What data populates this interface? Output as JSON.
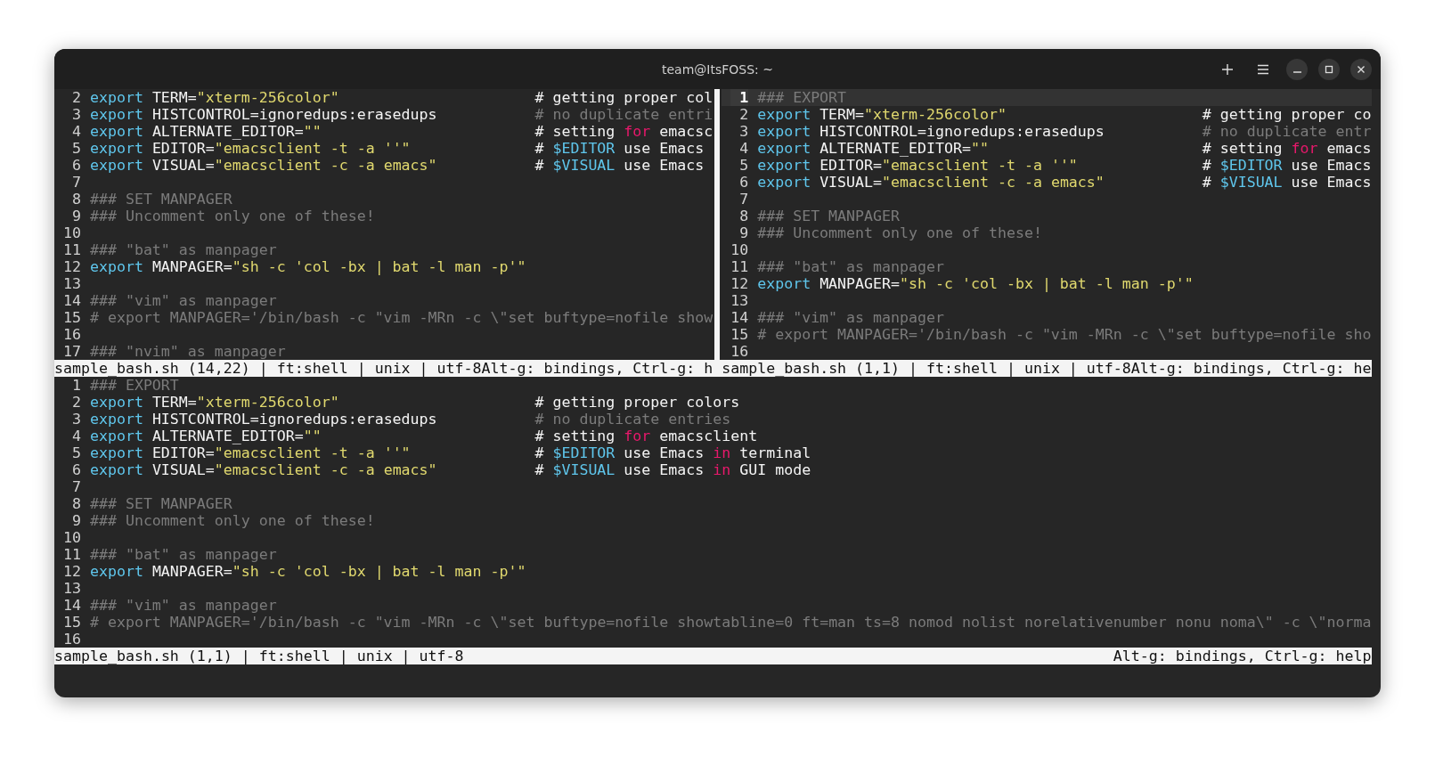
{
  "window": {
    "title": "team@ItsFOSS: ~"
  },
  "top_panes": [
    {
      "lines": [
        {
          "number": "2",
          "current": false,
          "code": [
            {
              "kind": "kw",
              "text": "export"
            },
            {
              "kind": "plain",
              "text": " TERM="
            },
            {
              "kind": "str",
              "text": "\"xterm-256color\""
            }
          ],
          "comment": [
            {
              "kind": "plain",
              "text": "# getting proper col"
            }
          ]
        },
        {
          "number": "3",
          "current": false,
          "code": [
            {
              "kind": "kw",
              "text": "export"
            },
            {
              "kind": "plain",
              "text": " HISTCONTROL=ignoredups:erasedups"
            }
          ],
          "comment": [
            {
              "kind": "com",
              "text": "# no duplicate entri"
            }
          ]
        },
        {
          "number": "4",
          "current": false,
          "code": [
            {
              "kind": "kw",
              "text": "export"
            },
            {
              "kind": "plain",
              "text": " ALTERNATE_EDITOR="
            },
            {
              "kind": "str",
              "text": "\"\""
            }
          ],
          "comment": [
            {
              "kind": "plain",
              "text": "# setting "
            },
            {
              "kind": "key",
              "text": "for"
            },
            {
              "kind": "plain",
              "text": " emacsc"
            }
          ]
        },
        {
          "number": "5",
          "current": false,
          "code": [
            {
              "kind": "kw",
              "text": "export"
            },
            {
              "kind": "plain",
              "text": " EDITOR="
            },
            {
              "kind": "str",
              "text": "\"emacsclient -t -a ''\""
            }
          ],
          "comment": [
            {
              "kind": "plain",
              "text": "# "
            },
            {
              "kind": "var",
              "text": "$EDITOR"
            },
            {
              "kind": "plain",
              "text": " use Emacs"
            }
          ]
        },
        {
          "number": "6",
          "current": false,
          "code": [
            {
              "kind": "kw",
              "text": "export"
            },
            {
              "kind": "plain",
              "text": " VISUAL="
            },
            {
              "kind": "str",
              "text": "\"emacsclient -c -a emacs\""
            }
          ],
          "comment": [
            {
              "kind": "plain",
              "text": "# "
            },
            {
              "kind": "var",
              "text": "$VISUAL"
            },
            {
              "kind": "plain",
              "text": " use Emacs"
            }
          ]
        },
        {
          "number": "7",
          "current": false
        },
        {
          "number": "8",
          "current": false,
          "code": [
            {
              "kind": "com",
              "text": "### SET MANPAGER"
            }
          ]
        },
        {
          "number": "9",
          "current": false,
          "code": [
            {
              "kind": "com",
              "text": "### Uncomment only one of these!"
            }
          ]
        },
        {
          "number": "10",
          "current": false
        },
        {
          "number": "11",
          "current": false,
          "code": [
            {
              "kind": "com",
              "text": "### \"bat\" as manpager"
            }
          ]
        },
        {
          "number": "12",
          "current": false,
          "code": [
            {
              "kind": "kw",
              "text": "export"
            },
            {
              "kind": "plain",
              "text": " MANPAGER="
            },
            {
              "kind": "str",
              "text": "\"sh -c 'col -bx | bat -l man -p'\""
            }
          ]
        },
        {
          "number": "13",
          "current": false
        },
        {
          "number": "14",
          "current": false,
          "code": [
            {
              "kind": "com",
              "text": "### \"vim\" as manpager"
            }
          ]
        },
        {
          "number": "15",
          "current": false,
          "code": [
            {
              "kind": "com",
              "text": "# export MANPAGER='/bin/bash -c \"vim -MRn -c \\\"set buftype=nofile show"
            }
          ]
        },
        {
          "number": "16",
          "current": false
        },
        {
          "number": "17",
          "current": false,
          "code": [
            {
              "kind": "com",
              "text": "### \"nvim\" as manpager"
            }
          ]
        }
      ],
      "status": "sample_bash.sh (14,22) | ft:shell | unix | utf-8Alt-g: bindings, Ctrl-g: h"
    },
    {
      "lines": [
        {
          "number": "1",
          "current": true,
          "code": [
            {
              "kind": "com",
              "text": "### EXPORT"
            }
          ]
        },
        {
          "number": "2",
          "current": false,
          "code": [
            {
              "kind": "kw",
              "text": "export"
            },
            {
              "kind": "plain",
              "text": " TERM="
            },
            {
              "kind": "str",
              "text": "\"xterm-256color\""
            }
          ],
          "comment": [
            {
              "kind": "plain",
              "text": "# getting proper co"
            }
          ]
        },
        {
          "number": "3",
          "current": false,
          "code": [
            {
              "kind": "kw",
              "text": "export"
            },
            {
              "kind": "plain",
              "text": " HISTCONTROL=ignoredups:erasedups"
            }
          ],
          "comment": [
            {
              "kind": "com",
              "text": "# no duplicate entr"
            }
          ]
        },
        {
          "number": "4",
          "current": false,
          "code": [
            {
              "kind": "kw",
              "text": "export"
            },
            {
              "kind": "plain",
              "text": " ALTERNATE_EDITOR="
            },
            {
              "kind": "str",
              "text": "\"\""
            }
          ],
          "comment": [
            {
              "kind": "plain",
              "text": "# setting "
            },
            {
              "kind": "key",
              "text": "for"
            },
            {
              "kind": "plain",
              "text": " emacs"
            }
          ]
        },
        {
          "number": "5",
          "current": false,
          "code": [
            {
              "kind": "kw",
              "text": "export"
            },
            {
              "kind": "plain",
              "text": " EDITOR="
            },
            {
              "kind": "str",
              "text": "\"emacsclient -t -a ''\""
            }
          ],
          "comment": [
            {
              "kind": "plain",
              "text": "# "
            },
            {
              "kind": "var",
              "text": "$EDITOR"
            },
            {
              "kind": "plain",
              "text": " use Emacs"
            }
          ]
        },
        {
          "number": "6",
          "current": false,
          "code": [
            {
              "kind": "kw",
              "text": "export"
            },
            {
              "kind": "plain",
              "text": " VISUAL="
            },
            {
              "kind": "str",
              "text": "\"emacsclient -c -a emacs\""
            }
          ],
          "comment": [
            {
              "kind": "plain",
              "text": "# "
            },
            {
              "kind": "var",
              "text": "$VISUAL"
            },
            {
              "kind": "plain",
              "text": " use Emacs"
            }
          ]
        },
        {
          "number": "7",
          "current": false
        },
        {
          "number": "8",
          "current": false,
          "code": [
            {
              "kind": "com",
              "text": "### SET MANPAGER"
            }
          ]
        },
        {
          "number": "9",
          "current": false,
          "code": [
            {
              "kind": "com",
              "text": "### Uncomment only one of these!"
            }
          ]
        },
        {
          "number": "10",
          "current": false
        },
        {
          "number": "11",
          "current": false,
          "code": [
            {
              "kind": "com",
              "text": "### \"bat\" as manpager"
            }
          ]
        },
        {
          "number": "12",
          "current": false,
          "code": [
            {
              "kind": "kw",
              "text": "export"
            },
            {
              "kind": "plain",
              "text": " MANPAGER="
            },
            {
              "kind": "str",
              "text": "\"sh -c 'col -bx | bat -l man -p'\""
            }
          ]
        },
        {
          "number": "13",
          "current": false
        },
        {
          "number": "14",
          "current": false,
          "code": [
            {
              "kind": "com",
              "text": "### \"vim\" as manpager"
            }
          ]
        },
        {
          "number": "15",
          "current": false,
          "code": [
            {
              "kind": "com",
              "text": "# export MANPAGER='/bin/bash -c \"vim -MRn -c \\\"set buftype=nofile sho"
            }
          ]
        },
        {
          "number": "16",
          "current": false
        }
      ],
      "status": "sample_bash.sh (1,1) | ft:shell | unix | utf-8Alt-g: bindings, Ctrl-g: he"
    }
  ],
  "bottom_pane": {
    "lines": [
      {
        "number": "1",
        "current": false,
        "code": [
          {
            "kind": "com",
            "text": "### EXPORT"
          }
        ]
      },
      {
        "number": "2",
        "current": false,
        "code": [
          {
            "kind": "kw",
            "text": "export"
          },
          {
            "kind": "plain",
            "text": " TERM="
          },
          {
            "kind": "str",
            "text": "\"xterm-256color\""
          }
        ],
        "comment": [
          {
            "kind": "plain",
            "text": "# getting proper colors"
          }
        ]
      },
      {
        "number": "3",
        "current": false,
        "code": [
          {
            "kind": "kw",
            "text": "export"
          },
          {
            "kind": "plain",
            "text": " HISTCONTROL=ignoredups:erasedups"
          }
        ],
        "comment": [
          {
            "kind": "com",
            "text": "# no duplicate entries"
          }
        ]
      },
      {
        "number": "4",
        "current": false,
        "code": [
          {
            "kind": "kw",
            "text": "export"
          },
          {
            "kind": "plain",
            "text": " ALTERNATE_EDITOR="
          },
          {
            "kind": "str",
            "text": "\"\""
          }
        ],
        "comment": [
          {
            "kind": "plain",
            "text": "# setting "
          },
          {
            "kind": "key",
            "text": "for"
          },
          {
            "kind": "plain",
            "text": " emacsclient"
          }
        ]
      },
      {
        "number": "5",
        "current": false,
        "code": [
          {
            "kind": "kw",
            "text": "export"
          },
          {
            "kind": "plain",
            "text": " EDITOR="
          },
          {
            "kind": "str",
            "text": "\"emacsclient -t -a ''\""
          }
        ],
        "comment": [
          {
            "kind": "plain",
            "text": "# "
          },
          {
            "kind": "var",
            "text": "$EDITOR"
          },
          {
            "kind": "plain",
            "text": " use Emacs "
          },
          {
            "kind": "key",
            "text": "in"
          },
          {
            "kind": "plain",
            "text": " terminal"
          }
        ]
      },
      {
        "number": "6",
        "current": false,
        "code": [
          {
            "kind": "kw",
            "text": "export"
          },
          {
            "kind": "plain",
            "text": " VISUAL="
          },
          {
            "kind": "str",
            "text": "\"emacsclient -c -a emacs\""
          }
        ],
        "comment": [
          {
            "kind": "plain",
            "text": "# "
          },
          {
            "kind": "var",
            "text": "$VISUAL"
          },
          {
            "kind": "plain",
            "text": " use Emacs "
          },
          {
            "kind": "key",
            "text": "in"
          },
          {
            "kind": "plain",
            "text": " GUI mode"
          }
        ]
      },
      {
        "number": "7",
        "current": false
      },
      {
        "number": "8",
        "current": false,
        "code": [
          {
            "kind": "com",
            "text": "### SET MANPAGER"
          }
        ]
      },
      {
        "number": "9",
        "current": false,
        "code": [
          {
            "kind": "com",
            "text": "### Uncomment only one of these!"
          }
        ]
      },
      {
        "number": "10",
        "current": false
      },
      {
        "number": "11",
        "current": false,
        "code": [
          {
            "kind": "com",
            "text": "### \"bat\" as manpager"
          }
        ]
      },
      {
        "number": "12",
        "current": false,
        "code": [
          {
            "kind": "kw",
            "text": "export"
          },
          {
            "kind": "plain",
            "text": " MANPAGER="
          },
          {
            "kind": "str",
            "text": "\"sh -c 'col -bx | bat -l man -p'\""
          }
        ]
      },
      {
        "number": "13",
        "current": false
      },
      {
        "number": "14",
        "current": false,
        "code": [
          {
            "kind": "com",
            "text": "### \"vim\" as manpager"
          }
        ]
      },
      {
        "number": "15",
        "current": false,
        "code": [
          {
            "kind": "com",
            "text": "# export MANPAGER='/bin/bash -c \"vim -MRn -c \\\"set buftype=nofile showtabline=0 ft=man ts=8 nomod nolist norelativenumber nonu noma\\\" -c \\\"norma"
          }
        ]
      },
      {
        "number": "16",
        "current": false
      }
    ],
    "status": {
      "left": "sample_bash.sh (1,1) | ft:shell | unix | utf-8",
      "right": "Alt-g: bindings, Ctrl-g: help"
    }
  }
}
